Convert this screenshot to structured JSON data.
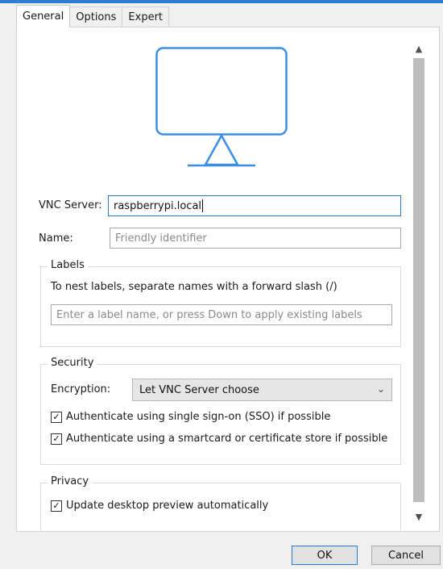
{
  "tabs": [
    {
      "label": "General",
      "active": true
    },
    {
      "label": "Options",
      "active": false
    },
    {
      "label": "Expert",
      "active": false
    }
  ],
  "icons": {
    "monitor": "monitor-icon",
    "scroll_up": "chevron-up-icon",
    "scroll_down": "chevron-down-icon",
    "select_arrow": "chevron-down-icon",
    "check": "checkmark-icon"
  },
  "colors": {
    "accent": "#2d7dd2",
    "monitor_stroke": "#3a8ee6",
    "focus_border": "#2b79c2"
  },
  "form": {
    "vnc_server_label": "VNC Server:",
    "vnc_server_value": "raspberrypi.local",
    "name_label": "Name:",
    "name_placeholder": "Friendly identifier"
  },
  "labels_group": {
    "title": "Labels",
    "hint": "To nest labels, separate names with a forward slash (/)",
    "placeholder": "Enter a label name, or press Down to apply existing labels"
  },
  "security_group": {
    "title": "Security",
    "encryption_label": "Encryption:",
    "encryption_value": "Let VNC Server choose",
    "sso_label": "Authenticate using single sign-on (SSO) if possible",
    "sso_checked": true,
    "smartcard_label": "Authenticate using a smartcard or certificate store if possible",
    "smartcard_checked": true
  },
  "privacy_group": {
    "title": "Privacy",
    "preview_label": "Update desktop preview automatically",
    "preview_checked": true
  },
  "buttons": {
    "ok": "OK",
    "cancel": "Cancel"
  }
}
